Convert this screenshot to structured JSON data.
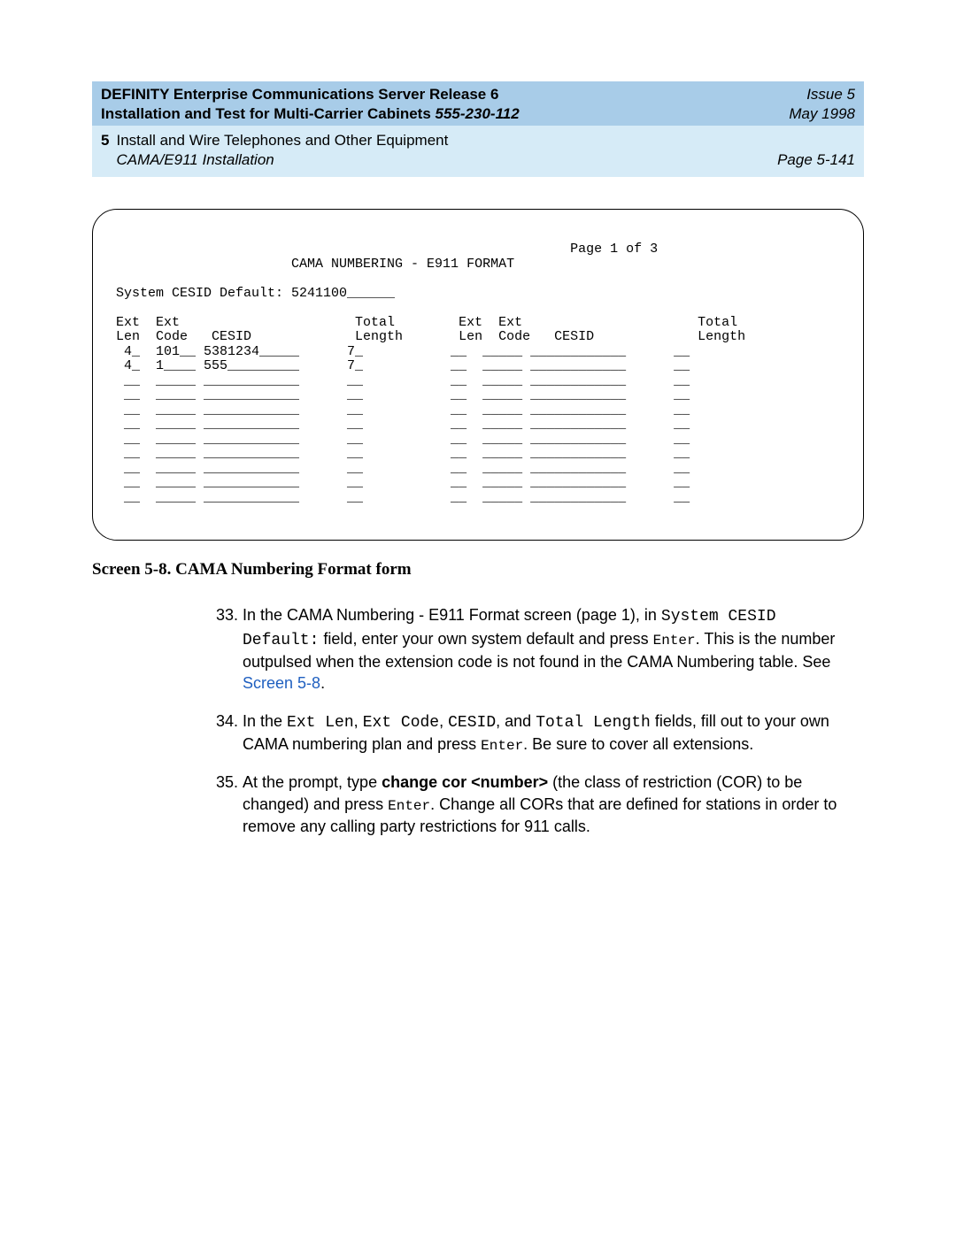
{
  "header": {
    "title_line1": "DEFINITY Enterprise Communications Server Release 6",
    "title_line2_a": "Installation and Test for Multi-Carrier Cabinets  ",
    "title_line2_docnum": "555-230-112",
    "issue": "Issue 5",
    "date": "May 1998",
    "chapter_num": "5",
    "chapter_title": "Install and Wire Telephones and Other Equipment",
    "section_title": "CAMA/E911 Installation",
    "page_label": "Page 5-141"
  },
  "terminal": {
    "page_indicator": "Page 1 of 3",
    "screen_title": "CAMA NUMBERING - E911 FORMAT",
    "default_label": "System CESID Default:",
    "default_value": "5241100",
    "col_headers_top": [
      "Ext",
      "Ext",
      "",
      "Total",
      "Ext",
      "Ext",
      "",
      "Total"
    ],
    "col_headers_bottom": [
      "Len",
      "Code",
      "CESID",
      "Length",
      "Len",
      "Code",
      "CESID",
      "Length"
    ],
    "rows_left": [
      {
        "len": "4",
        "code": "101",
        "cesid": "5381234",
        "total": "7"
      },
      {
        "len": "4",
        "code": "1",
        "cesid": "555",
        "total": "7"
      },
      {
        "len": "",
        "code": "",
        "cesid": "",
        "total": ""
      },
      {
        "len": "",
        "code": "",
        "cesid": "",
        "total": ""
      },
      {
        "len": "",
        "code": "",
        "cesid": "",
        "total": ""
      },
      {
        "len": "",
        "code": "",
        "cesid": "",
        "total": ""
      },
      {
        "len": "",
        "code": "",
        "cesid": "",
        "total": ""
      },
      {
        "len": "",
        "code": "",
        "cesid": "",
        "total": ""
      },
      {
        "len": "",
        "code": "",
        "cesid": "",
        "total": ""
      },
      {
        "len": "",
        "code": "",
        "cesid": "",
        "total": ""
      },
      {
        "len": "",
        "code": "",
        "cesid": "",
        "total": ""
      }
    ],
    "rows_right": [
      {
        "len": "",
        "code": "",
        "cesid": "",
        "total": ""
      },
      {
        "len": "",
        "code": "",
        "cesid": "",
        "total": ""
      },
      {
        "len": "",
        "code": "",
        "cesid": "",
        "total": ""
      },
      {
        "len": "",
        "code": "",
        "cesid": "",
        "total": ""
      },
      {
        "len": "",
        "code": "",
        "cesid": "",
        "total": ""
      },
      {
        "len": "",
        "code": "",
        "cesid": "",
        "total": ""
      },
      {
        "len": "",
        "code": "",
        "cesid": "",
        "total": ""
      },
      {
        "len": "",
        "code": "",
        "cesid": "",
        "total": ""
      },
      {
        "len": "",
        "code": "",
        "cesid": "",
        "total": ""
      },
      {
        "len": "",
        "code": "",
        "cesid": "",
        "total": ""
      },
      {
        "len": "",
        "code": "",
        "cesid": "",
        "total": ""
      }
    ]
  },
  "caption": "Screen 5-8.   CAMA Numbering Format form",
  "steps": {
    "start": 33,
    "s33": {
      "p1a": "In the CAMA Numbering - E911 Format screen (page 1), in ",
      "p1b": "System CESID Default:",
      "p1c": " field, enter your own system default and press ",
      "p1d": "Enter",
      "p1e": ". This is the number outpulsed when the extension code is not found in the CAMA Numbering table. See ",
      "p1link": "Screen 5-8",
      "p1f": "."
    },
    "s34": {
      "p1a": "In the ",
      "f1": "Ext Len",
      "p1b": ", ",
      "f2": "Ext Code",
      "p1c": ", ",
      "f3": "CESID",
      "p1d": ", and ",
      "f4": "Total Length",
      "p1e": " fields, fill out to your own CAMA numbering plan and press ",
      "p1enter": "Enter",
      "p1f": ". Be sure to cover all extensions."
    },
    "s35": {
      "p1a": "At the prompt, type ",
      "cmd": "change cor",
      "arg": " <number>",
      "p1b": " (the class of restriction (COR) to be changed) and press ",
      "p1enter": "Enter",
      "p1c": ". Change all CORs that are defined for stations in order to remove any calling party restrictions for 911 calls."
    }
  }
}
